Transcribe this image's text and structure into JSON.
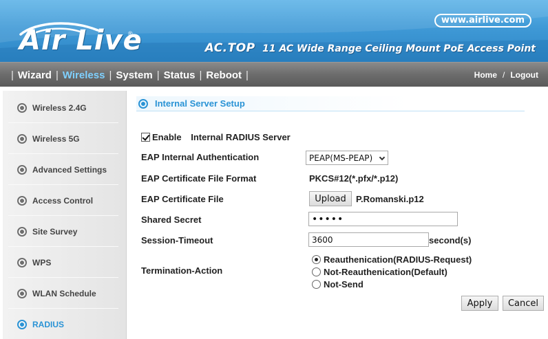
{
  "header": {
    "brand": "Air Live",
    "brand_mark": "®",
    "site_url": "www.airlive.com",
    "model_name": "AC.TOP",
    "model_desc": "11 AC Wide Range Ceiling Mount PoE Access Point"
  },
  "nav": {
    "items": [
      {
        "label": "Wizard",
        "active": false
      },
      {
        "label": "Wireless",
        "active": true
      },
      {
        "label": "System",
        "active": false
      },
      {
        "label": "Status",
        "active": false
      },
      {
        "label": "Reboot",
        "active": false
      }
    ],
    "separator": "|",
    "home": "Home",
    "slash": "/",
    "logout": "Logout"
  },
  "sidebar": {
    "items": [
      {
        "label": "Wireless 2.4G",
        "active": false
      },
      {
        "label": "Wireless 5G",
        "active": false
      },
      {
        "label": "Advanced Settings",
        "active": false
      },
      {
        "label": "Access Control",
        "active": false
      },
      {
        "label": "Site Survey",
        "active": false
      },
      {
        "label": "WPS",
        "active": false
      },
      {
        "label": "WLAN Schedule",
        "active": false
      },
      {
        "label": "RADIUS",
        "active": true
      }
    ]
  },
  "main": {
    "section_title": "Internal Server Setup",
    "enable_label": "Enable",
    "enable_checked": true,
    "enable_suffix": "Internal RADIUS Server",
    "eap_auth_label": "EAP Internal Authentication",
    "eap_auth_value": "PEAP(MS-PEAP)",
    "cert_format_label": "EAP Certificate File Format",
    "cert_format_value": "PKCS#12(*.pfx/*.p12)",
    "cert_file_label": "EAP Certificate File",
    "upload_label": "Upload",
    "cert_file_name": "P.Romanski.p12",
    "shared_secret_label": "Shared Secret",
    "shared_secret_value": "•••••",
    "session_timeout_label": "Session-Timeout",
    "session_timeout_value": "3600",
    "session_timeout_unit": "second(s)",
    "termination_label": "Termination-Action",
    "termination_options": [
      {
        "label": "Reauthenication(RADIUS-Request)",
        "checked": true
      },
      {
        "label": "Not-Reauthenication(Default)",
        "checked": false
      },
      {
        "label": "Not-Send",
        "checked": false
      }
    ],
    "apply_label": "Apply",
    "cancel_label": "Cancel"
  },
  "colors": {
    "accent": "#2a93d5",
    "banner_blue": "#3f99d6",
    "nav_gray": "#6c6c6c",
    "nav_active": "#7fd0ff"
  }
}
